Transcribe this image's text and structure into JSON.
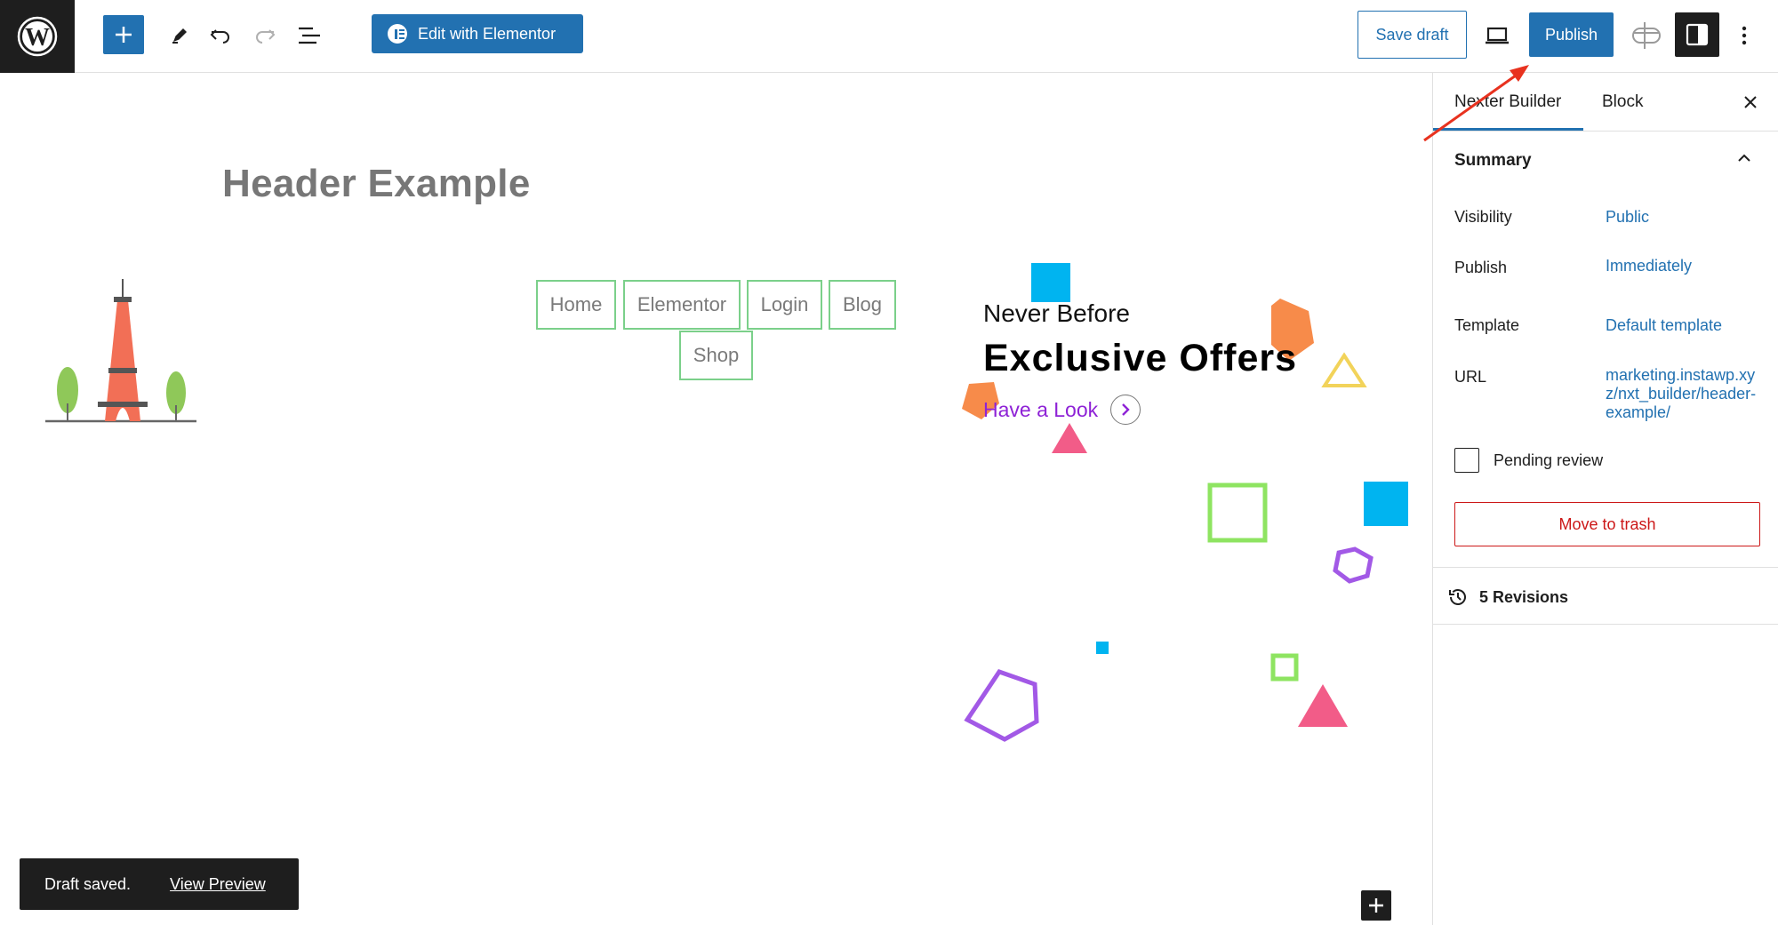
{
  "toolbar": {
    "edit_with_elementor": "Edit with Elementor",
    "save_draft": "Save draft",
    "publish": "Publish"
  },
  "canvas": {
    "page_title": "Header Example",
    "nav_menu": [
      "Home",
      "Elementor",
      "Login",
      "Blog",
      "Shop"
    ],
    "promo": {
      "kicker": "Never Before",
      "title": "Exclusive Offers",
      "link": "Have a Look"
    }
  },
  "sidebar": {
    "tabs": [
      "Nexter Builder",
      "Block"
    ],
    "active_tab": "Nexter Builder",
    "summary_title": "Summary",
    "rows": [
      {
        "label": "Visibility",
        "value": "Public"
      },
      {
        "label": "Publish",
        "value": "Immediately"
      },
      {
        "label": "Template",
        "value": "Default template"
      },
      {
        "label": "URL",
        "value": "marketing.instawp.xyz/nxt_builder/header-example/"
      }
    ],
    "pending_review": "Pending review",
    "move_to_trash": "Move to trash",
    "revisions": "5 Revisions"
  },
  "snackbar": {
    "message": "Draft saved.",
    "action": "View Preview"
  },
  "colors": {
    "accent": "#2271b1",
    "danger": "#cc1818",
    "dark": "#1e1e1e",
    "link_purple": "#8e22d6",
    "nav_border": "#7bd08a",
    "annotation_arrow": "#e8321f"
  },
  "icons": [
    "wordpress-logo-icon",
    "plus-icon",
    "pencil-icon",
    "undo-icon",
    "redo-icon",
    "list-view-icon",
    "elementor-icon",
    "laptop-preview-icon",
    "nexter-icon",
    "sidebar-toggle-icon",
    "more-vertical-icon",
    "close-icon",
    "chevron-up-icon",
    "history-icon",
    "chevron-right-icon"
  ]
}
